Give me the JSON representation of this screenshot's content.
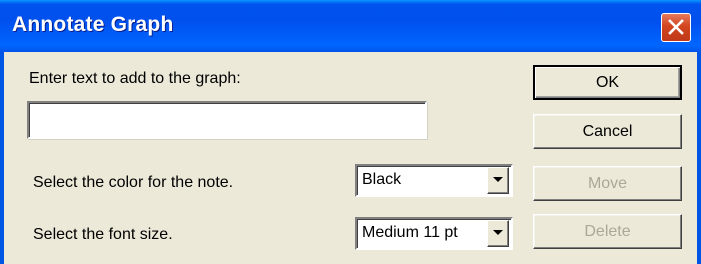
{
  "window": {
    "title": "Annotate Graph"
  },
  "form": {
    "text_prompt": "Enter text to add to the graph:",
    "text_value": "",
    "color_prompt": "Select the color for the note.",
    "color_selected": "Black",
    "font_prompt": "Select the font size.",
    "font_selected": "Medium 11 pt"
  },
  "buttons": {
    "ok": "OK",
    "cancel": "Cancel",
    "move": "Move",
    "delete": "Delete"
  },
  "colors": {
    "titlebar": "#0055e5",
    "dialog_bg": "#ece9d8",
    "disabled_text": "#aca899",
    "close_button": "#d2451f"
  },
  "icons": {
    "close": "close-icon",
    "dropdown": "chevron-down-icon"
  }
}
